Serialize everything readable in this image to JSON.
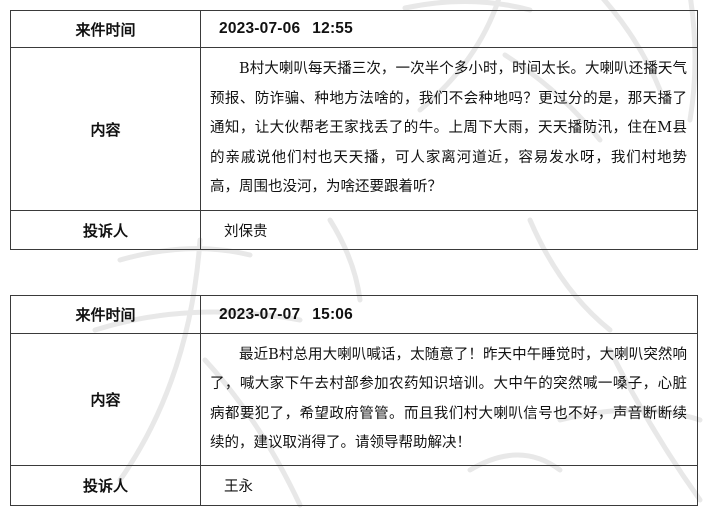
{
  "watermark": {
    "text": "天晓",
    "color": "#e6e6e6"
  },
  "records": [
    {
      "time_label": "来件时间",
      "date": "2023-07-06",
      "time": "12:55",
      "content_label": "内容",
      "content": "B村大喇叭每天播三次，一次半个多小时，时间太长。大喇叭还播天气预报、防诈骗、种地方法啥的，我们不会种地吗？更过分的是，那天播了通知，让大伙帮老王家找丢了的牛。上周下大雨，天天播防汛，住在M县的亲戚说他们村也天天播，可人家离河道近，容易发水呀，我们村地势高，周围也没河，为啥还要跟着听？",
      "complainant_label": "投诉人",
      "complainant": "刘保贵"
    },
    {
      "time_label": "来件时间",
      "date": "2023-07-07",
      "time": "15:06",
      "content_label": "内容",
      "content": "最近B村总用大喇叭喊话，太随意了！昨天中午睡觉时，大喇叭突然响了，喊大家下午去村部参加农药知识培训。大中午的突然喊一嗓子，心脏病都要犯了，希望政府管管。而且我们村大喇叭信号也不好，声音断断续续的，建议取消得了。请领导帮助解决！",
      "complainant_label": "投诉人",
      "complainant": "王永"
    }
  ]
}
